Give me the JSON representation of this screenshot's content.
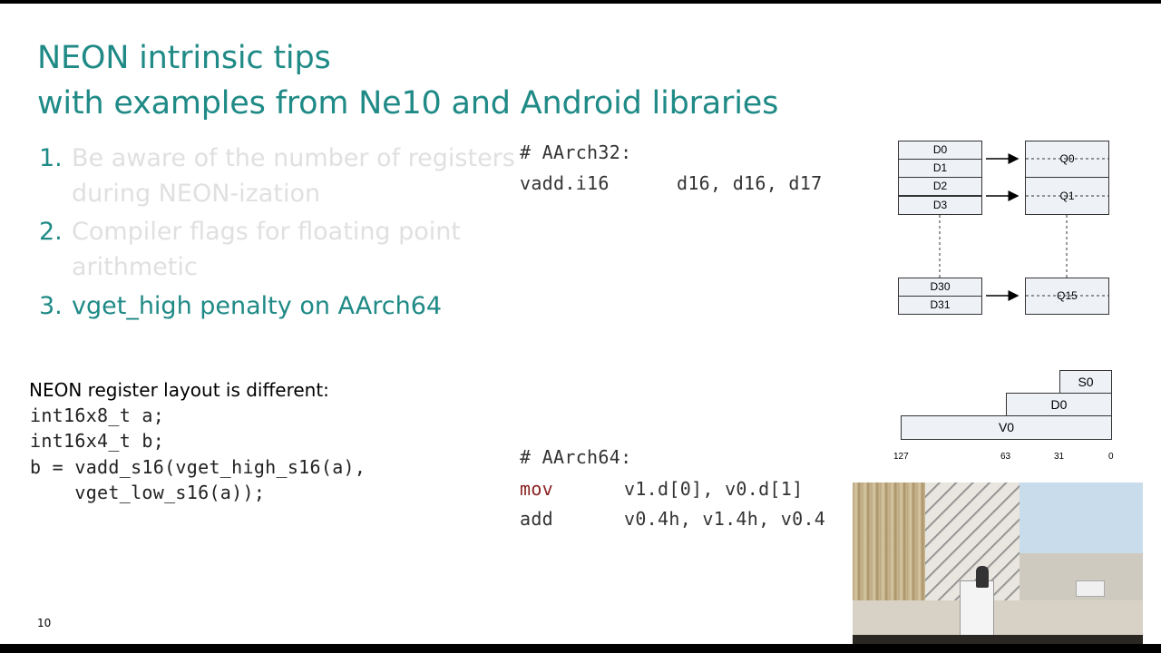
{
  "slide": {
    "title_line1": "NEON intrinsic tips",
    "title_line2": "with examples from Ne10 and Android libraries",
    "page_number": "10",
    "list": [
      {
        "num": "1.",
        "line1": "Be aware of the number of registers",
        "line2": "during NEON-ization",
        "state": "dimmed"
      },
      {
        "num": "2.",
        "line1": "Compiler flags for floating point",
        "line2": "arithmetic",
        "state": "dimmed"
      },
      {
        "num": "3.",
        "line1": "vget_high penalty on AArch64",
        "line2": "",
        "state": "active"
      }
    ],
    "caption": "NEON register layout is different:",
    "left_code": [
      "int16x8_t a;",
      "int16x4_t b;",
      "b = vadd_s16(vget_high_s16(a),",
      "    vget_low_s16(a));"
    ],
    "aarch32": {
      "comment": "# AArch32:",
      "instr": "vadd.i16",
      "operands": "d16, d16, d17"
    },
    "aarch64": {
      "comment": "# AArch64:",
      "line1_op": "mov",
      "line1_args": "v1.d[0], v0.d[1]",
      "line2_op": "add",
      "line2_args": "v0.4h, v1.4h, v0.4"
    }
  },
  "diagram32": {
    "d_regs": [
      "D0",
      "D1",
      "D2",
      "D3",
      "D30",
      "D31"
    ],
    "q_regs": [
      "Q0",
      "Q1",
      "Q15"
    ]
  },
  "diagram64": {
    "regs": [
      "S0",
      "D0",
      "V0"
    ],
    "bit_ticks": [
      "127",
      "63",
      "31",
      "0"
    ]
  },
  "colors": {
    "teal": "#1f8a86",
    "dim_text": "#e0e0e0",
    "mov_red": "#8b2222"
  }
}
